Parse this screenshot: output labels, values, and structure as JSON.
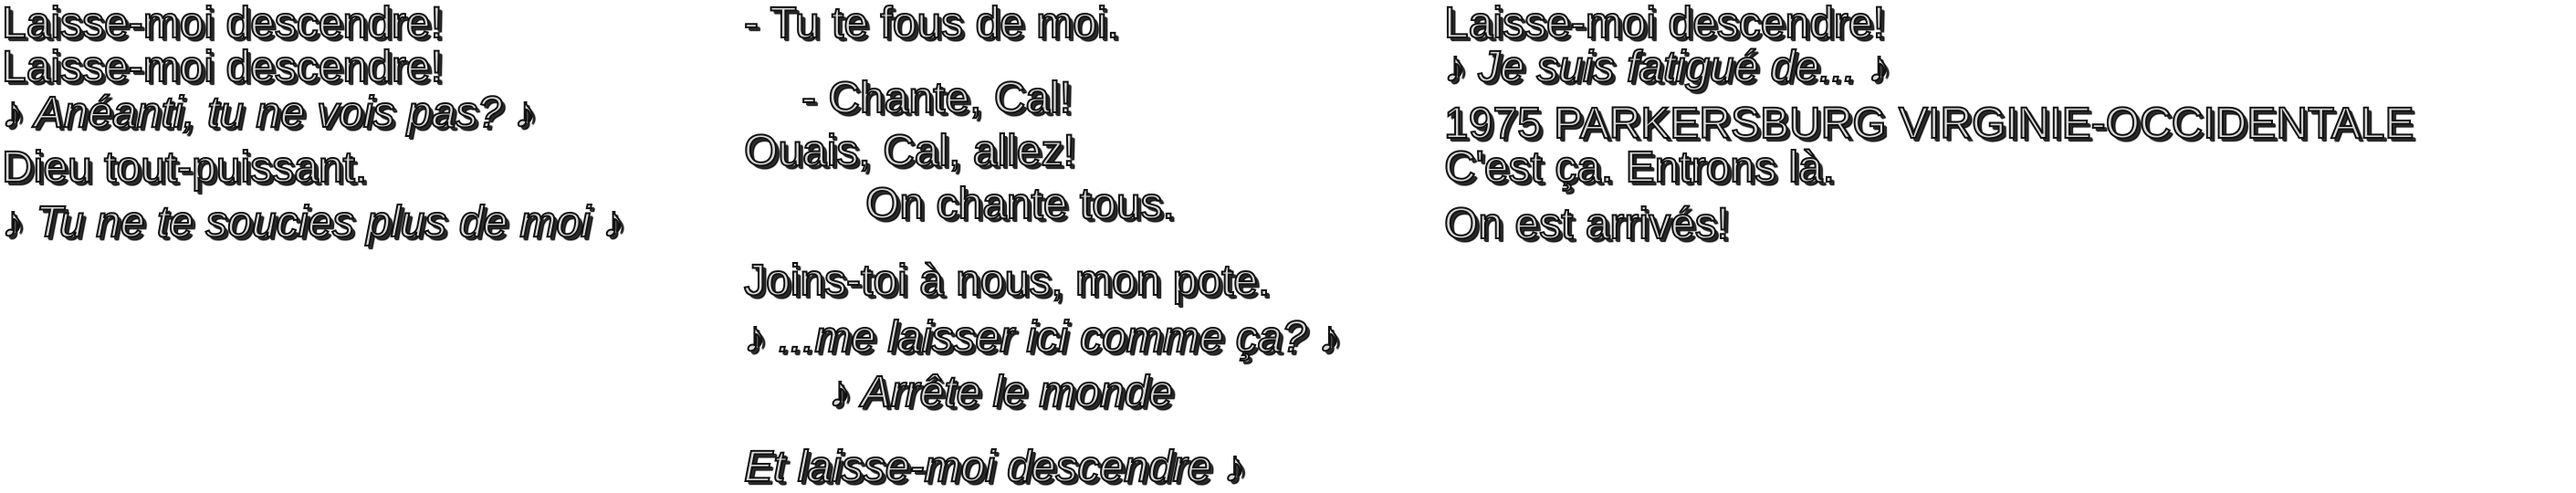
{
  "subtitles": {
    "col1": [
      {
        "text": "Laisse-moi descendre!",
        "italic": false
      },
      {
        "text": "Laisse-moi descendre!",
        "italic": false
      },
      {
        "text": "♪ Anéanti, tu ne vois pas? ♪",
        "italic": true
      },
      {
        "text": "Dieu tout-puissant.",
        "italic": false
      },
      {
        "text": "♪ Tu ne te soucies plus de moi ♪",
        "italic": true
      }
    ],
    "col2": [
      {
        "text": "- Tu te fous de moi.",
        "italic": false
      },
      {
        "text": "- Chante, Cal!",
        "italic": false
      },
      {
        "text": "Ouais, Cal, allez!",
        "italic": false
      },
      {
        "text": "On chante tous.",
        "italic": false
      },
      {
        "text": "Joins-toi à nous, mon pote.",
        "italic": false
      },
      {
        "text": "♪ ...me laisser ici comme ça? ♪",
        "italic": true
      },
      {
        "text": "♪ Arrête le monde",
        "italic": true
      },
      {
        "text": "Et laisse-moi descendre ♪",
        "italic": true
      }
    ],
    "col3": [
      {
        "text": "Laisse-moi descendre!",
        "italic": false
      },
      {
        "text": "♪ Je suis fatigué de... ♪",
        "italic": true
      },
      {
        "text": "1975 PARKERSBURG VIRGINIE-OCCIDENTALE",
        "italic": false
      },
      {
        "text": "C'est ça. Entrons là.",
        "italic": false
      },
      {
        "text": "On est arrivés!",
        "italic": false
      }
    ]
  },
  "colors": {
    "background": "#ffffff",
    "text_fill": "#d9d9d9",
    "text_outline": "#111111"
  }
}
